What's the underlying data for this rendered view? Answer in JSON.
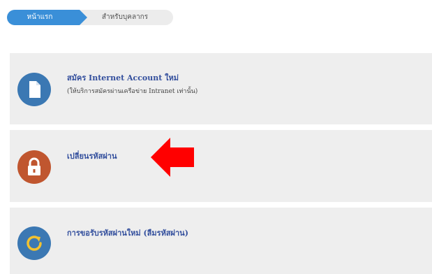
{
  "breadcrumb": {
    "home_label": "หน้าแรก",
    "staff_label": "สำหรับบุคลากร"
  },
  "items": [
    {
      "title": "สมัคร Internet Account ใหม่",
      "subtitle": "(ให้บริการสมัครผ่านเครือข่าย Intranet เท่านั้น)",
      "icon": "document-icon",
      "color": "#3b78b3"
    },
    {
      "title": "เปลี่ยนรหัสผ่าน",
      "icon": "padlock-icon",
      "color": "#c0562f"
    },
    {
      "title": "การขอรับรหัสผ่านใหม่ (ลืมรหัสผ่าน)",
      "icon": "refresh-icon",
      "color": "#3b78b3"
    }
  ],
  "colors": {
    "link": "#334f9d",
    "tab_active": "#3a8fd8",
    "annotation_arrow": "#ff0000"
  }
}
